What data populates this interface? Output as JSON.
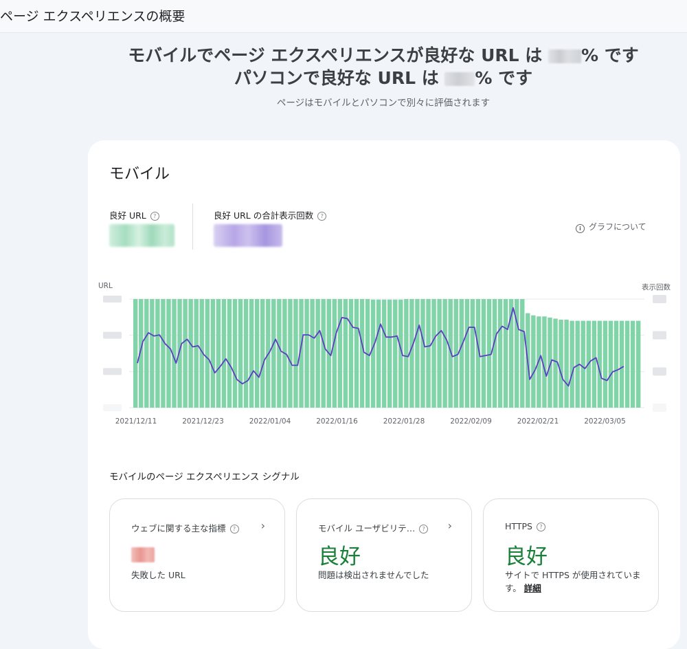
{
  "header": {
    "title": "ページ エクスペリエンスの概要"
  },
  "hero": {
    "mobile_prefix": "モバイルでページ エクスペリエンスが良好な URL は ",
    "mobile_suffix": "% です",
    "desktop_prefix": "パソコンで良好な URL は ",
    "desktop_suffix": "% です",
    "subtitle": "ページはモバイルとパソコンで別々に評価されます"
  },
  "mobile_card": {
    "title": "モバイル",
    "metric_good_urls_label": "良好 URL",
    "metric_impressions_label": "良好 URL の合計表示回数",
    "about_graph": "グラフについて",
    "help_glyph": "?",
    "info_glyph": "i"
  },
  "colors": {
    "bar": "#81d4a8",
    "line": "#5c3dc4",
    "good": "#188038"
  },
  "chart_data": {
    "type": "bar",
    "left_axis_label": "URL",
    "right_axis_label": "表示回数",
    "x_tick_labels": [
      "2021/12/11",
      "2021/12/23",
      "2022/01/04",
      "2022/01/16",
      "2022/01/28",
      "2022/02/09",
      "2022/02/21",
      "2022/03/05"
    ],
    "bars_url_fraction": [
      1,
      1,
      1,
      1,
      1,
      1,
      1,
      1,
      1,
      1,
      1,
      1,
      1,
      1,
      1,
      1,
      1,
      1,
      1,
      1,
      1,
      1,
      1,
      1,
      1,
      1,
      1,
      1,
      1,
      1,
      1,
      1,
      1,
      1,
      1,
      1,
      1,
      1,
      1,
      1,
      1,
      1,
      1,
      0.995,
      0.995,
      0.995,
      0.995,
      0.995,
      0.995,
      1,
      1,
      1,
      1,
      1,
      1,
      1,
      1,
      1,
      1,
      1,
      1,
      1,
      1,
      1,
      1,
      1,
      1,
      1,
      1,
      1,
      1,
      0.87,
      0.85,
      0.84,
      0.84,
      0.83,
      0.82,
      0.81,
      0.81,
      0.8,
      0.8,
      0.8,
      0.8,
      0.8,
      0.8,
      0.8,
      0.8,
      0.8,
      0.8,
      0.8,
      0.8,
      0.8
    ],
    "line_impressions_fraction": [
      0.41,
      0.61,
      0.69,
      0.66,
      0.67,
      0.59,
      0.54,
      0.41,
      0.59,
      0.63,
      0.56,
      0.57,
      0.49,
      0.44,
      0.32,
      0.38,
      0.45,
      0.37,
      0.26,
      0.22,
      0.25,
      0.34,
      0.28,
      0.44,
      0.52,
      0.63,
      0.52,
      0.49,
      0.39,
      0.39,
      0.67,
      0.67,
      0.64,
      0.71,
      0.54,
      0.48,
      0.69,
      0.83,
      0.82,
      0.74,
      0.73,
      0.51,
      0.48,
      0.6,
      0.77,
      0.65,
      0.65,
      0.66,
      0.48,
      0.47,
      0.6,
      0.76,
      0.56,
      0.57,
      0.66,
      0.71,
      0.62,
      0.47,
      0.49,
      0.61,
      0.74,
      0.74,
      0.47,
      0.48,
      0.49,
      0.68,
      0.75,
      0.72,
      0.92,
      0.72,
      0.7,
      0.26,
      0.35,
      0.48,
      0.29,
      0.44,
      0.42,
      0.26,
      0.2,
      0.37,
      0.4,
      0.36,
      0.43,
      0.46,
      0.27,
      0.25,
      0.33,
      0.35,
      0.38
    ]
  },
  "signals": {
    "title": "モバイルのページ エクスペリエンス シグナル",
    "cards": [
      {
        "label": "ウェブに関する主な指標",
        "desc": "失敗した URL",
        "chevron": "›"
      },
      {
        "label": "モバイル ユーザビリテ…",
        "good": "良好",
        "desc": "問題は検出されませんでした",
        "chevron": "›"
      },
      {
        "label": "HTTPS",
        "good": "良好",
        "desc": "サイトで HTTPS が使用されています。",
        "link": "詳細"
      }
    ]
  }
}
